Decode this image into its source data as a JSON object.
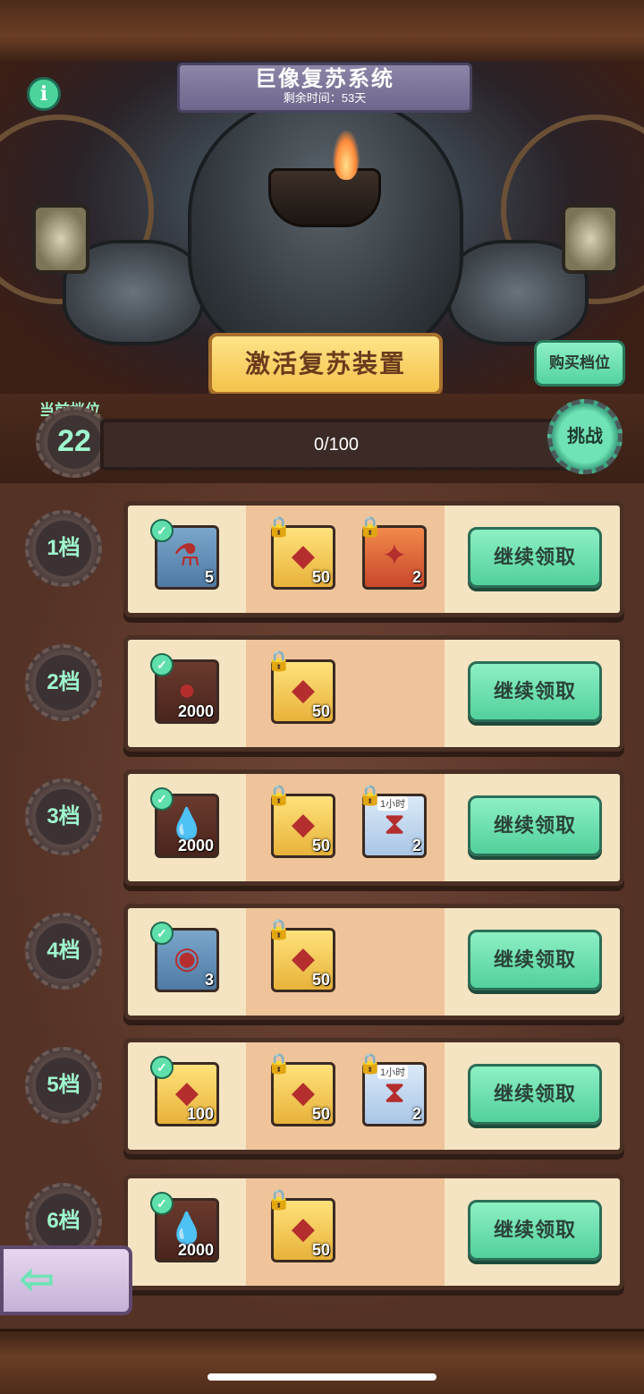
{
  "header": {
    "title": "巨像复苏系统",
    "time_left": "剩余时间：53天",
    "info_icon": "i"
  },
  "actions": {
    "activate": "激活复苏装置",
    "buy_level": "购买档位",
    "challenge": "挑战"
  },
  "progress": {
    "current_label": "当前档位",
    "current_level": "22",
    "text": "0/100",
    "fraction": 0.0
  },
  "tiers": [
    {
      "label": "1档",
      "claim": "继续领取",
      "items": [
        {
          "icon": "potion-icon",
          "count": "5",
          "unlocked": true
        },
        {
          "icon": "ruby-icon",
          "count": "50",
          "unlocked": false
        },
        {
          "icon": "puzzle-piece-icon",
          "count": "2",
          "unlocked": false
        }
      ]
    },
    {
      "label": "2档",
      "claim": "继续领取",
      "items": [
        {
          "icon": "ore-icon",
          "count": "2000",
          "unlocked": true
        },
        {
          "icon": "ruby-icon",
          "count": "50",
          "unlocked": false
        }
      ]
    },
    {
      "label": "3档",
      "claim": "继续领取",
      "items": [
        {
          "icon": "water-drop-icon",
          "count": "2000",
          "unlocked": true
        },
        {
          "icon": "ruby-icon",
          "count": "50",
          "unlocked": false
        },
        {
          "icon": "hourglass-water-icon",
          "count": "2",
          "tag": "1小时",
          "unlocked": false
        }
      ]
    },
    {
      "label": "4档",
      "claim": "继续领取",
      "items": [
        {
          "icon": "orb-icon",
          "count": "3",
          "unlocked": true
        },
        {
          "icon": "ruby-icon",
          "count": "50",
          "unlocked": false
        }
      ]
    },
    {
      "label": "5档",
      "claim": "继续领取",
      "items": [
        {
          "icon": "ruby-icon",
          "count": "100",
          "unlocked": true
        },
        {
          "icon": "ruby-icon",
          "count": "50",
          "unlocked": false
        },
        {
          "icon": "hourglass-ore-icon",
          "count": "2",
          "tag": "1小时",
          "unlocked": false
        }
      ]
    },
    {
      "label": "6档",
      "claim": "继续领取",
      "items": [
        {
          "icon": "water-drop-icon",
          "count": "2000",
          "unlocked": true
        },
        {
          "icon": "ruby-icon",
          "count": "50",
          "unlocked": false
        }
      ]
    }
  ],
  "nav": {
    "back_icon": "arrow-left-icon"
  }
}
